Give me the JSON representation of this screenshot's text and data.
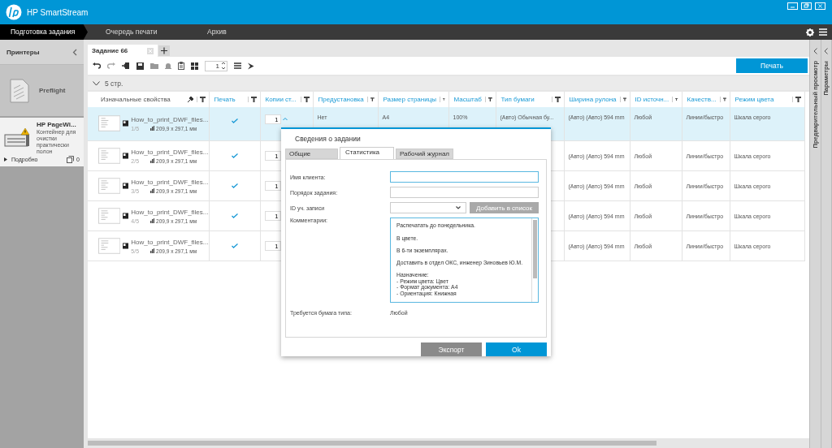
{
  "app": {
    "title": "HP SmartStream"
  },
  "nav": {
    "tabs": [
      {
        "label": "Подготовка задания",
        "selected": true
      },
      {
        "label": "Очередь печати",
        "selected": false
      },
      {
        "label": "Архив",
        "selected": false
      }
    ]
  },
  "sidebar": {
    "title": "Принтеры",
    "items": [
      {
        "kind": "preflight",
        "name": "Preflight",
        "selected": false
      },
      {
        "kind": "printer",
        "name": "HP PageWi...",
        "status": "Контейнер для очистки практически полон",
        "warning": true,
        "details": "Подробно",
        "count": "0",
        "selected": true
      }
    ]
  },
  "job_tabs": [
    {
      "label": "Задание 66",
      "selected": true
    }
  ],
  "toolbar": {
    "page": "1",
    "print_button": "Печать"
  },
  "group": {
    "label": "5 стр.",
    "expanded": true
  },
  "table": {
    "columns": [
      {
        "label": "Изначальные свойства",
        "pinned": true
      },
      {
        "label": "Печать",
        "pinned": false
      },
      {
        "label": "Копии ст...",
        "pinned": false
      },
      {
        "label": "Предустановка",
        "pinned": false
      },
      {
        "label": "Размер страницы",
        "pinned": false
      },
      {
        "label": "Масштаб",
        "pinned": false
      },
      {
        "label": "Тип бумаги",
        "pinned": false
      },
      {
        "label": "Ширина рулона",
        "pinned": false
      },
      {
        "label": "ID источн...",
        "pinned": false
      },
      {
        "label": "Качеств...",
        "pinned": false
      },
      {
        "label": "Режим цвета",
        "pinned": false
      }
    ],
    "rows": [
      {
        "selected": true,
        "name": "How_to_print_DWF_files...",
        "page": "1/5",
        "size": "209,9 x 297,1 мм",
        "print": true,
        "copies": "1",
        "preset": "Нет",
        "page_size": "A4",
        "scale": "100%",
        "paper_type": "(Авто) Обычная бу...",
        "roll_width": "(Авто) (Авто) 594 mm",
        "source_id": "Любой",
        "quality": "Линии/быстро",
        "color_mode": "Шкала серого"
      },
      {
        "selected": false,
        "name": "How_to_print_DWF_files...",
        "page": "2/5",
        "size": "209,9 x 297,1 мм",
        "print": true,
        "copies": "1",
        "roll_width": "(Авто) (Авто) 594 mm",
        "source_id": "Любой",
        "quality": "Линии/быстро",
        "color_mode": "Шкала серого"
      },
      {
        "selected": false,
        "name": "How_to_print_DWF_files...",
        "page": "3/5",
        "size": "209,9 x 297,1 мм",
        "print": true,
        "copies": "1",
        "roll_width": "(Авто) (Авто) 594 mm",
        "source_id": "Любой",
        "quality": "Линии/быстро",
        "color_mode": "Шкала серого"
      },
      {
        "selected": false,
        "name": "How_to_print_DWF_files...",
        "page": "4/5",
        "size": "209,9 x 297,1 мм",
        "print": true,
        "copies": "1",
        "roll_width": "(Авто) (Авто) 594 mm",
        "source_id": "Любой",
        "quality": "Линии/быстро",
        "color_mode": "Шкала серого"
      },
      {
        "selected": false,
        "name": "How_to_print_DWF_files...",
        "page": "5/5",
        "size": "209,9 x 297,1 мм",
        "print": true,
        "copies": "1",
        "roll_width": "(Авто) (Авто) 594 mm",
        "source_id": "Любой",
        "quality": "Линии/быстро",
        "color_mode": "Шкала серого"
      }
    ]
  },
  "dialog": {
    "title": "Сведения о задании",
    "tabs": [
      {
        "label": "Общие",
        "selected": false
      },
      {
        "label": "Статистика",
        "selected": true
      },
      {
        "label": "Рабочий журнал",
        "selected": false
      }
    ],
    "client": {
      "label": "Имя клиента:",
      "focused": true
    },
    "order": {
      "label": "Порядок задания:",
      "focused": false
    },
    "account": {
      "label": "ID уч. записи",
      "add_button": "Добавить в список",
      "add_disabled": true
    },
    "comments": {
      "label": "Комментарии:",
      "focused": true,
      "value": "Распечатать до понедельника.\n\nВ цвете.\n\nВ 6-ти экземплярах.\n\nДоставить в отдел ОКС, инженер Зиновьев Ю.М.\n\nНазначение:\n- Режим цвета: Цвет\n- Формат документа: A4\n- Ориентация: Книжная"
    },
    "paper": {
      "label": "Требуется бумага типа:",
      "value": "Любой"
    },
    "buttons": [
      {
        "label": "Экспорт",
        "kind": "secondary"
      },
      {
        "label": "Ok",
        "kind": "primary"
      }
    ]
  },
  "panels": [
    {
      "label": "Предварительный просмотр"
    },
    {
      "label": "Параметры"
    }
  ]
}
